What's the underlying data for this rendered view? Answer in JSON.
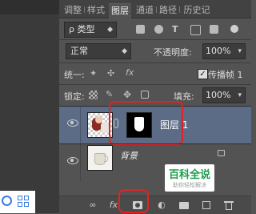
{
  "tabs": [
    {
      "label": "调整"
    },
    {
      "label": "样式"
    },
    {
      "label": "图层"
    },
    {
      "label": "通道"
    },
    {
      "label": "路径"
    },
    {
      "label": "历史记"
    }
  ],
  "filter": {
    "kind_label": "ρ 类型"
  },
  "blend": {
    "mode": "正常",
    "opacity_label": "不透明度:",
    "opacity_value": "100%"
  },
  "unify": {
    "label": "统一:",
    "propagate_label": "传播帧 1"
  },
  "lock": {
    "label": "锁定:",
    "fill_label": "填充:",
    "fill_value": "100%"
  },
  "layers": [
    {
      "name": "图层 1"
    },
    {
      "name": "背景"
    }
  ],
  "watermark": {
    "title": "百科全说",
    "subtitle": "助你轻松解决"
  },
  "colors": {
    "highlight_red": "#e22222",
    "panel": "#535353",
    "selected_row": "#5c6c86"
  }
}
